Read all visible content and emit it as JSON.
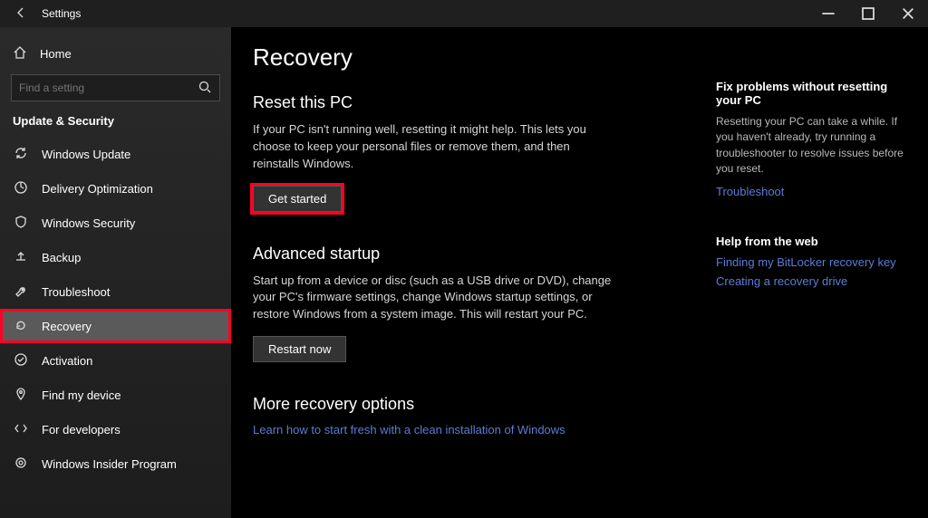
{
  "titlebar": {
    "title": "Settings"
  },
  "sidebar": {
    "home_label": "Home",
    "search_placeholder": "Find a setting",
    "category_label": "Update & Security",
    "items": [
      {
        "label": "Windows Update"
      },
      {
        "label": "Delivery Optimization"
      },
      {
        "label": "Windows Security"
      },
      {
        "label": "Backup"
      },
      {
        "label": "Troubleshoot"
      },
      {
        "label": "Recovery"
      },
      {
        "label": "Activation"
      },
      {
        "label": "Find my device"
      },
      {
        "label": "For developers"
      },
      {
        "label": "Windows Insider Program"
      }
    ]
  },
  "main": {
    "page_title": "Recovery",
    "reset": {
      "title": "Reset this PC",
      "desc": "If your PC isn't running well, resetting it might help. This lets you choose to keep your personal files or remove them, and then reinstalls Windows.",
      "button": "Get started"
    },
    "advanced": {
      "title": "Advanced startup",
      "desc": "Start up from a device or disc (such as a USB drive or DVD), change your PC's firmware settings, change Windows startup settings, or restore Windows from a system image. This will restart your PC.",
      "button": "Restart now"
    },
    "more": {
      "title": "More recovery options",
      "link": "Learn how to start fresh with a clean installation of Windows"
    }
  },
  "right": {
    "fix": {
      "title": "Fix problems without resetting your PC",
      "desc": "Resetting your PC can take a while. If you haven't already, try running a troubleshooter to resolve issues before you reset.",
      "link": "Troubleshoot"
    },
    "help": {
      "title": "Help from the web",
      "link1": "Finding my BitLocker recovery key",
      "link2": "Creating a recovery drive"
    }
  }
}
